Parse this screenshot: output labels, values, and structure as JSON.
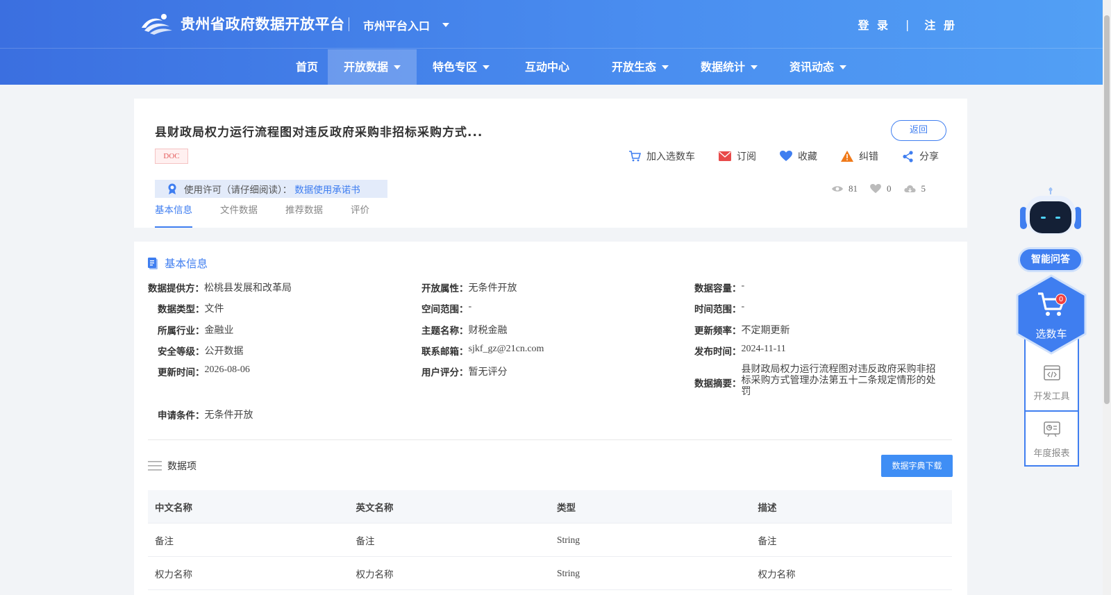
{
  "header": {
    "site_title": "贵州省政府数据开放平台",
    "city_entry": "市州平台入口",
    "login": "登 录",
    "separator": "|",
    "register": "注 册"
  },
  "nav": {
    "items": [
      {
        "label": "首页",
        "dropdown": false,
        "active": false
      },
      {
        "label": "开放数据",
        "dropdown": true,
        "active": true
      },
      {
        "label": "特色专区",
        "dropdown": true,
        "active": false
      },
      {
        "label": "互动中心",
        "dropdown": false,
        "active": false
      },
      {
        "label": "开放生态",
        "dropdown": true,
        "active": false
      },
      {
        "label": "数据统计",
        "dropdown": true,
        "active": false
      },
      {
        "label": "资讯动态",
        "dropdown": true,
        "active": false
      }
    ]
  },
  "dataset": {
    "title": "县财政局权力运行流程图对违反政府采购非招标采购方式...",
    "format_tag": "DOC",
    "back_label": "返回",
    "actions": {
      "add_cart": "加入选数车",
      "subscribe": "订阅",
      "favorite": "收藏",
      "report": "纠错",
      "share": "分享"
    },
    "license_label": "使用许可（请仔细阅读）：",
    "license_link": "数据使用承诺书",
    "stats": {
      "views": "81",
      "likes": "0",
      "downloads": "5"
    },
    "tabs": [
      "基本信息",
      "文件数据",
      "推荐数据",
      "评价"
    ]
  },
  "basic_info": {
    "section_title": "基本信息",
    "fields": {
      "provider": {
        "k": "数据提供方：",
        "v": "松桃县发展和改革局"
      },
      "open_attr": {
        "k": "开放属性：",
        "v": "无条件开放"
      },
      "capacity": {
        "k": "数据容量：",
        "v": "-"
      },
      "data_type": {
        "k": "数据类型：",
        "v": "文件"
      },
      "space_range": {
        "k": "空间范围：",
        "v": "-"
      },
      "time_range": {
        "k": "时间范围：",
        "v": "-"
      },
      "industry": {
        "k": "所属行业：",
        "v": "金融业"
      },
      "topic": {
        "k": "主题名称：",
        "v": "财税金融"
      },
      "frequency": {
        "k": "更新频率：",
        "v": "不定期更新"
      },
      "security": {
        "k": "安全等级：",
        "v": "公开数据"
      },
      "email": {
        "k": "联系邮箱：",
        "v": "sjkf_gz@21cn.com"
      },
      "publish_time": {
        "k": "发布时间：",
        "v": "2024-11-11"
      },
      "update_time": {
        "k": "更新时间：",
        "v": "2026-08-06"
      },
      "rating": {
        "k": "用户评分：",
        "v": "暂无评分"
      },
      "summary": {
        "k": "数据摘要：",
        "v": "县财政局权力运行流程图对违反政府采购非招标采购方式管理办法第五十二条规定情形的处罚"
      },
      "condition": {
        "k": "申请条件：",
        "v": "无条件开放"
      }
    }
  },
  "data_items": {
    "title": "数据项",
    "download_label": "数据字典下载",
    "columns": [
      "中文名称",
      "英文名称",
      "类型",
      "描述"
    ],
    "rows": [
      [
        "备注",
        "备注",
        "String",
        "备注"
      ],
      [
        "权力名称",
        "权力名称",
        "String",
        "权力名称"
      ]
    ]
  },
  "side_widget": {
    "qa_label": "智能问答",
    "cart_label": "选数车",
    "cart_count": "0",
    "dev_tools": "开发工具",
    "annual_report": "年度报表"
  },
  "colors": {
    "primary": "#3f7ef0",
    "header_start": "#3b6fe0",
    "header_end": "#52a0f5",
    "subscribe_red": "#e84a4a",
    "warning_orange": "#f07a1a"
  }
}
